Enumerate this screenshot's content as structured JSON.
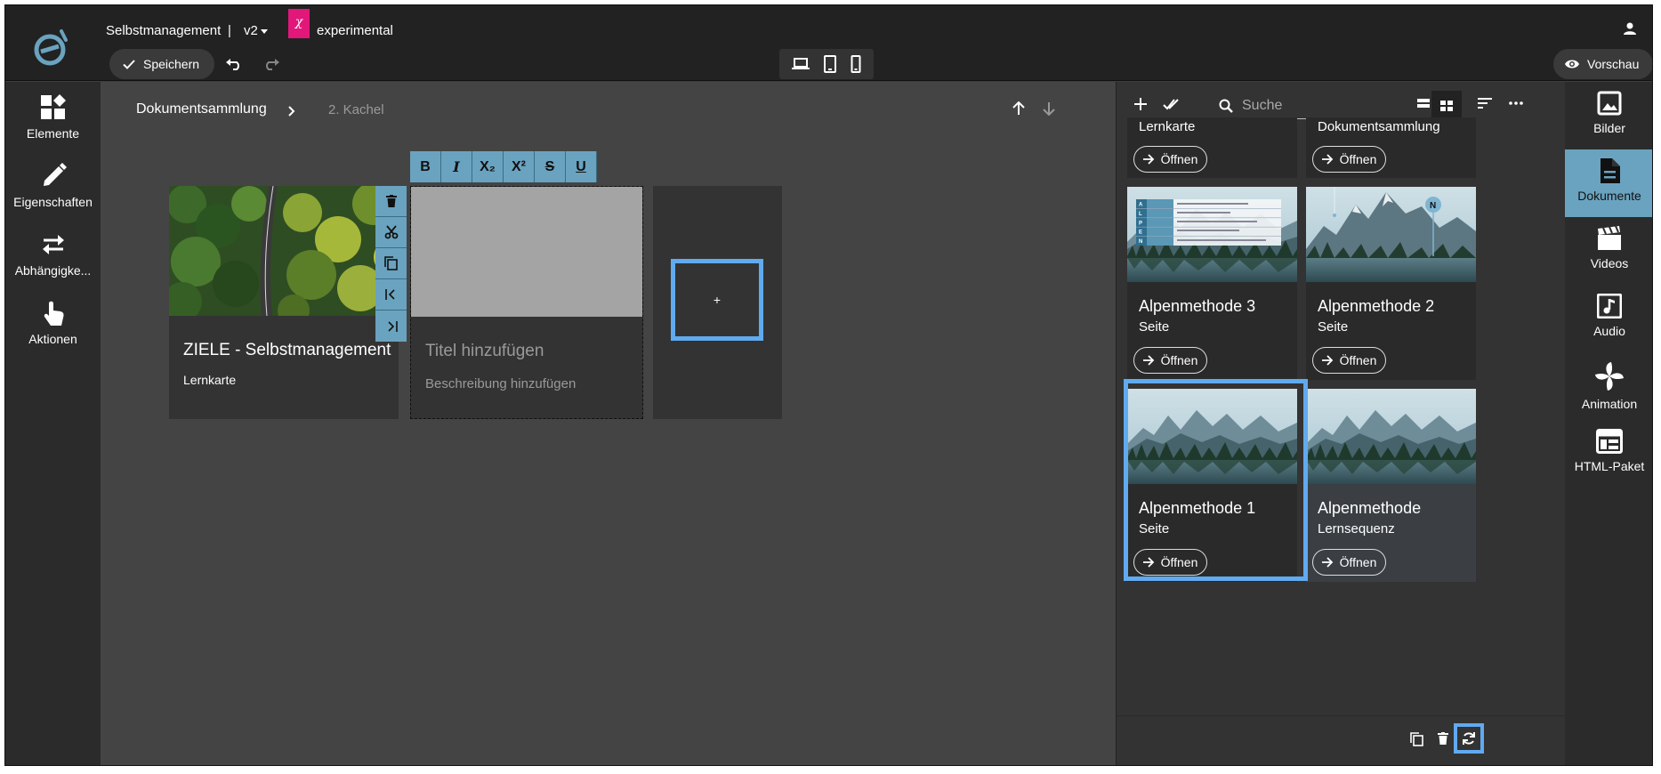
{
  "topbar": {
    "doc_title": "Selbstmanagement",
    "separator": "|",
    "version": "v2",
    "experimental_symbol": "χ",
    "experimental_label": "experimental",
    "save_label": "Speichern",
    "preview_label": "Vorschau"
  },
  "leftbar": {
    "items": [
      {
        "label": "Elemente",
        "icon": "elements-icon"
      },
      {
        "label": "Eigenschaften",
        "icon": "pencil-icon"
      },
      {
        "label": "Abhängigke...",
        "icon": "swap-arrows-icon"
      },
      {
        "label": "Aktionen",
        "icon": "touch-hand-icon"
      }
    ]
  },
  "canvas": {
    "breadcrumb": [
      "Dokumentsammlung",
      "2. Kachel"
    ],
    "tile1": {
      "title": "ZIELE - Selbstmanagement",
      "subtitle": "Lernkarte"
    },
    "tile2": {
      "title_placeholder": "Titel hinzufügen",
      "desc_placeholder": "Beschreibung hinzufügen"
    },
    "add_label": "+",
    "format_buttons": [
      "B",
      "I",
      "X₂",
      "X²",
      "S",
      "U"
    ]
  },
  "panel": {
    "search_placeholder": "Suche",
    "open_label": "Öffnen",
    "cards": [
      {
        "title": "",
        "subtitle": "Lernkarte"
      },
      {
        "title": "",
        "subtitle": "Dokumentsammlung"
      },
      {
        "title": "Alpenmethode 3",
        "subtitle": "Seite"
      },
      {
        "title": "Alpenmethode 2",
        "subtitle": "Seite"
      },
      {
        "title": "Alpenmethode 1",
        "subtitle": "Seite"
      },
      {
        "title": "Alpenmethode",
        "subtitle": "Lernsequenz"
      }
    ],
    "card3_table_letters": [
      "A",
      "L",
      "P",
      "E",
      "N"
    ]
  },
  "rail": {
    "items": [
      {
        "label": "Bilder",
        "icon": "image-icon"
      },
      {
        "label": "Dokumente",
        "icon": "document-icon"
      },
      {
        "label": "Videos",
        "icon": "clapperboard-icon"
      },
      {
        "label": "Audio",
        "icon": "music-note-icon"
      },
      {
        "label": "Animation",
        "icon": "pinwheel-icon"
      },
      {
        "label": "HTML-Paket",
        "icon": "html-package-icon"
      }
    ],
    "active": "Dokumente"
  },
  "colors": {
    "accent_blue": "#60aaf0",
    "tool_blue": "#6aa3bf",
    "experimental_pink": "#e2177a"
  }
}
